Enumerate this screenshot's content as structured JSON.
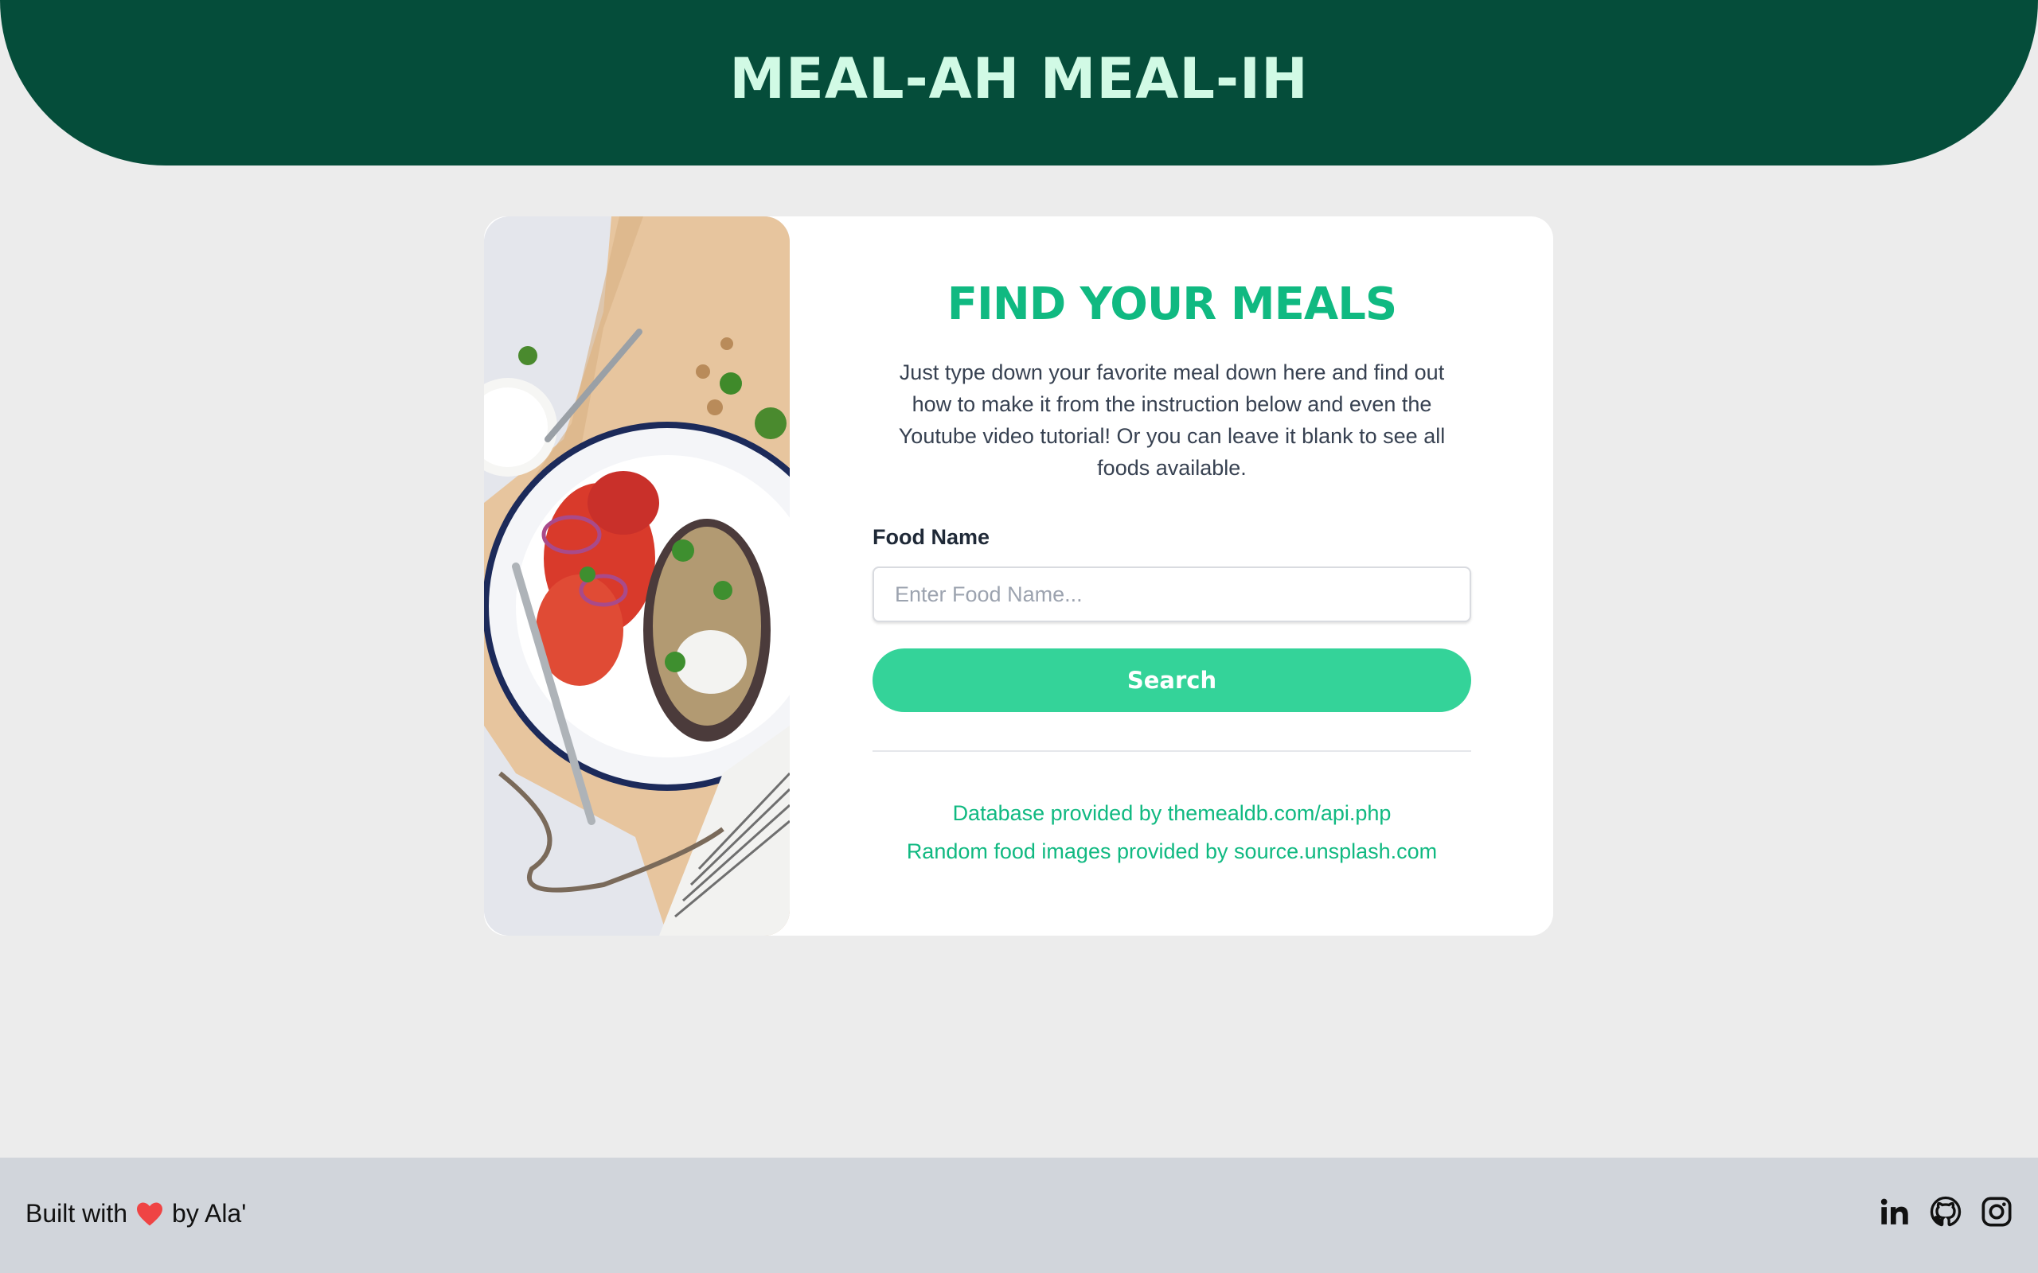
{
  "header": {
    "title": "MEAL-AH MEAL-IH"
  },
  "card": {
    "image_alt": "plate of food",
    "heading": "FIND YOUR MEALS",
    "description_lines": [
      "Just type down your favorite meal down here and find out",
      "how to make it from the instruction below and even the",
      "Youtube video tutorial! Or you can leave it blank to see all",
      "foods available."
    ],
    "field_label": "Food Name",
    "input_placeholder": "Enter Food Name...",
    "input_value": "",
    "search_label": "Search",
    "credits": [
      "Database provided by themealdb.com/api.php",
      "Random food images provided by source.unsplash.com"
    ]
  },
  "footer": {
    "built_prefix": "Built with",
    "built_suffix": "by Ala'",
    "heart_icon": "heart-icon",
    "social": [
      "linkedin-icon",
      "github-icon",
      "instagram-icon"
    ]
  },
  "colors": {
    "header_bg": "#054d3a",
    "header_text": "#d1fae5",
    "accent": "#10b981",
    "button": "#34d399",
    "page_bg": "#ececec",
    "footer_bg": "#d1d5db",
    "heart": "#ef4444"
  }
}
